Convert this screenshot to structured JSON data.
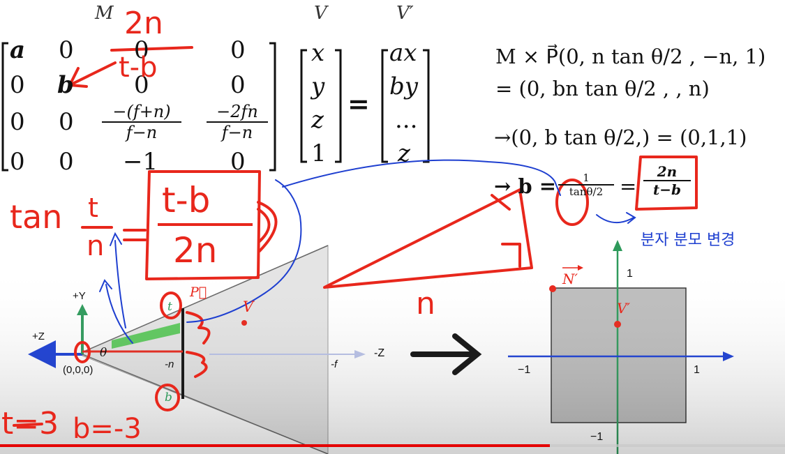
{
  "matrix": {
    "label_m": "M",
    "label_v": "V",
    "label_vp": "V′",
    "cells": {
      "r1c1": "a",
      "r1c2": "0",
      "r1c3": "0",
      "r1c4": "0",
      "r2c1": "0",
      "r2c2": "b",
      "r2c3": "0",
      "r2c4": "0",
      "r3c1": "0",
      "r3c2": "0",
      "r3c3_num": "−(f+n)",
      "r3c3_den": "f−n",
      "r3c4_num": "−2fn",
      "r3c4_den": "f−n",
      "r4c1": "0",
      "r4c2": "0",
      "r4c3": "−1",
      "r4c4": "0"
    },
    "v_vector": [
      "x",
      "y",
      "z",
      "1"
    ],
    "equals": "=",
    "vp_vector": [
      "ax",
      "by",
      "...",
      "z"
    ]
  },
  "equations": {
    "line1": "M × P⃗(0, n tan θ/2 , −n, 1)",
    "line2": "= (0, bn tan θ/2 , , n)",
    "line3": "→(0, b tan θ/2,) = (0,1,1)",
    "line4_lhs": "→ b =",
    "line4_frac_num": "1",
    "line4_frac_den": "tanθ/2",
    "line4_eq": "=",
    "line4_rhs_num": "2n",
    "line4_rhs_den": "t−b"
  },
  "handwriting": {
    "top_2n": "2n",
    "top_frac_num": "2n",
    "top_frac_den": "t-b",
    "tan_eq": "tan",
    "tan_frac_num": "t",
    "tan_frac_den": "n",
    "boxed_num": "t-b",
    "boxed_den": "2n",
    "n_label": "n",
    "korean_note": "분자 분모 변경",
    "t_eq": "t=3",
    "b_eq": "b=-3"
  },
  "frustum": {
    "plus_y": "+Y",
    "plus_z": "+Z",
    "origin": "(0,0,0)",
    "theta": "θ",
    "t_label": "t",
    "b_label": "b",
    "p_label": "P⃗",
    "v_label": "V",
    "neg_n": "-n",
    "neg_f": "-f",
    "neg_z": "-Z"
  },
  "ndc": {
    "n_prime": "N′",
    "v_prime": "V′",
    "one_top": "1",
    "neg_one_left": "−1",
    "one_right": "1",
    "neg_one_bottom": "−1"
  },
  "player": {
    "progress": 0.7
  },
  "colors": {
    "red_ink": "#e8271c",
    "blue_ink": "#1e3fd0",
    "green_axis": "#2e9a5b",
    "blue_axis": "#1b3fd6",
    "progress_red": "#e40000"
  }
}
